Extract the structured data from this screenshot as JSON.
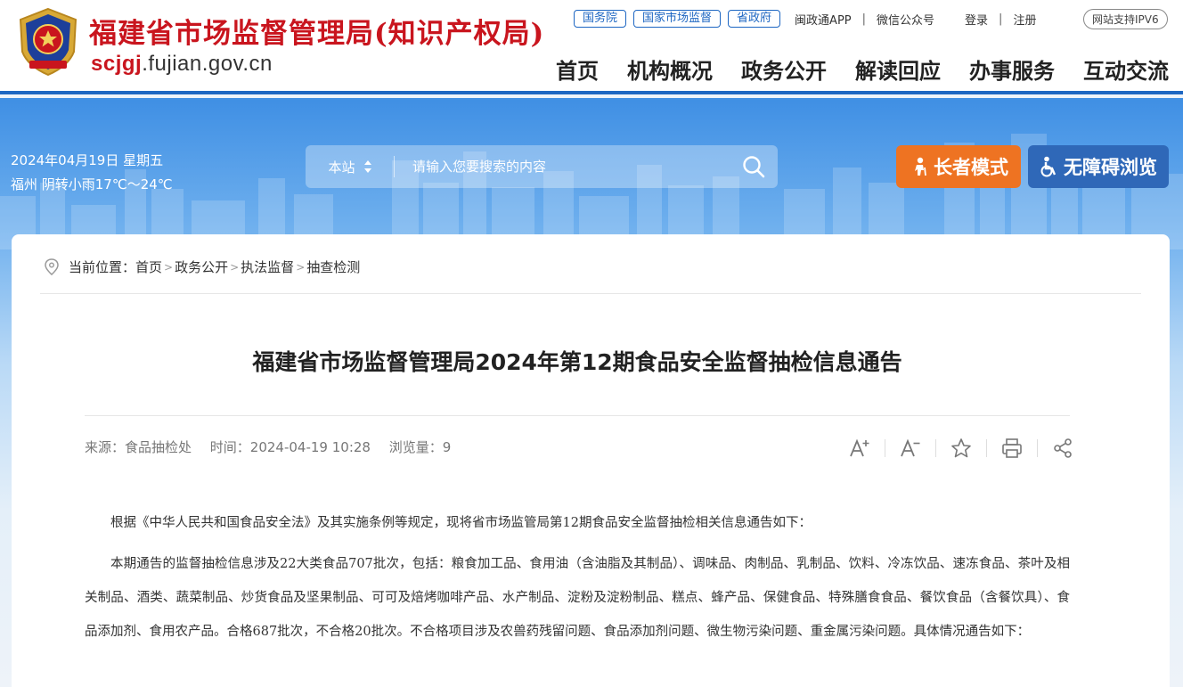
{
  "header": {
    "title": "福建省市场监督管理局(知识产权局)",
    "domain_highlight": "scjgj",
    "domain_rest": ".fujian.gov.cn",
    "top_pills": [
      "国务院",
      "国家市场监督",
      "省政府"
    ],
    "app_link": "闽政通APP",
    "wechat_link": "微信公众号",
    "login": "登录",
    "register": "注册",
    "ipv6": "网站支持IPV6",
    "nav": [
      "首页",
      "机构概况",
      "政务公开",
      "解读回应",
      "办事服务",
      "互动交流"
    ]
  },
  "banner": {
    "date": "2024年04月19日 星期五",
    "weather": "福州 阴转小雨17℃～24℃",
    "search_scope": "本站",
    "search_placeholder": "请输入您要搜索的内容",
    "elder_mode": "长者模式",
    "accessible_mode": "无障碍浏览"
  },
  "breadcrumb": {
    "prefix": "当前位置：",
    "items": [
      "首页",
      "政务公开",
      "执法监督",
      "抽查检测"
    ]
  },
  "article": {
    "title": "福建省市场监督管理局2024年第12期食品安全监督抽检信息通告",
    "source": "来源：食品抽检处",
    "time": "时间：2024-04-19 10:28",
    "views": "浏览量：9",
    "paragraphs": [
      "根据《中华人民共和国食品安全法》及其实施条例等规定，现将省市场监管局第12期食品安全监督抽检相关信息通告如下：",
      "本期通告的监督抽检信息涉及22大类食品707批次，包括：粮食加工品、食用油（含油脂及其制品）、调味品、肉制品、乳制品、饮料、冷冻饮品、速冻食品、茶叶及相关制品、酒类、蔬菜制品、炒货食品及坚果制品、可可及焙烤咖啡产品、水产制品、淀粉及淀粉制品、糕点、蜂产品、保健食品、特殊膳食食品、餐饮食品（含餐饮具）、食品添加剂、食用农产品。合格687批次，不合格20批次。不合格项目涉及农兽药残留问题、食品添加剂问题、微生物污染问题、重金属污染问题。具体情况通告如下："
    ]
  },
  "colors": {
    "brand_red": "#c9151e",
    "brand_blue": "#1d66c2",
    "elder_orange": "#ee7322",
    "access_blue": "#2f68b8"
  }
}
